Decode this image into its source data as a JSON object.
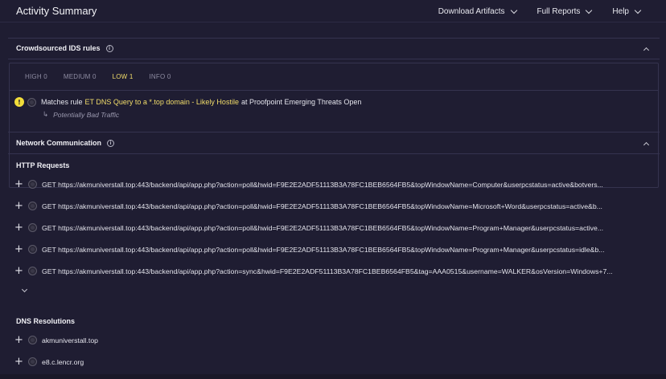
{
  "app": {
    "title": "Activity Summary"
  },
  "nav": [
    {
      "label": "Download Artifacts"
    },
    {
      "label": "Full Reports"
    },
    {
      "label": "Help"
    }
  ],
  "ids_section": {
    "title": "Crowdsourced IDS rules",
    "tabs": [
      "HIGH 0",
      "MEDIUM 0",
      "LOW 1",
      "INFO 0"
    ],
    "active_tab": "LOW 1",
    "rule": {
      "prefix": "Matches rule",
      "link": "ET DNS Query to a *.top domain - Likely Hostile",
      "suffix": "at Proofpoint Emerging Threats Open",
      "category": "Potentially Bad Traffic"
    }
  },
  "network_section": {
    "title": "Network Communication",
    "http_title": "HTTP Requests",
    "http_requests": [
      "GET https://akmuniverstall.top:443/backend/api/app.php?action=poll&hwid=F9E2E2ADF51113B3A78FC1BEB6564FB5&topWindowName=Computer&userpcstatus=active&botvers...",
      "GET https://akmuniverstall.top:443/backend/api/app.php?action=poll&hwid=F9E2E2ADF51113B3A78FC1BEB6564FB5&topWindowName=Microsoft+Word&userpcstatus=active&b...",
      "GET https://akmuniverstall.top:443/backend/api/app.php?action=poll&hwid=F9E2E2ADF51113B3A78FC1BEB6564FB5&topWindowName=Program+Manager&userpcstatus=active...",
      "GET https://akmuniverstall.top:443/backend/api/app.php?action=poll&hwid=F9E2E2ADF51113B3A78FC1BEB6564FB5&topWindowName=Program+Manager&userpcstatus=idle&b...",
      "GET https://akmuniverstall.top:443/backend/api/app.php?action=sync&hwid=F9E2E2ADF51113B3A78FC1BEB6564FB5&tag=AAA0515&username=WALKER&osVersion=Windows+7..."
    ],
    "dns_title": "DNS Resolutions",
    "dns": [
      "akmuniverstall.top",
      "e8.c.lencr.org"
    ]
  },
  "colors": {
    "background": "#1f1d32",
    "accent": "#f2dd6a",
    "warning": "#f2dd3a"
  },
  "icons": {
    "info": "i",
    "warning": "!",
    "plus": "+",
    "sub_arrow": "↳"
  }
}
